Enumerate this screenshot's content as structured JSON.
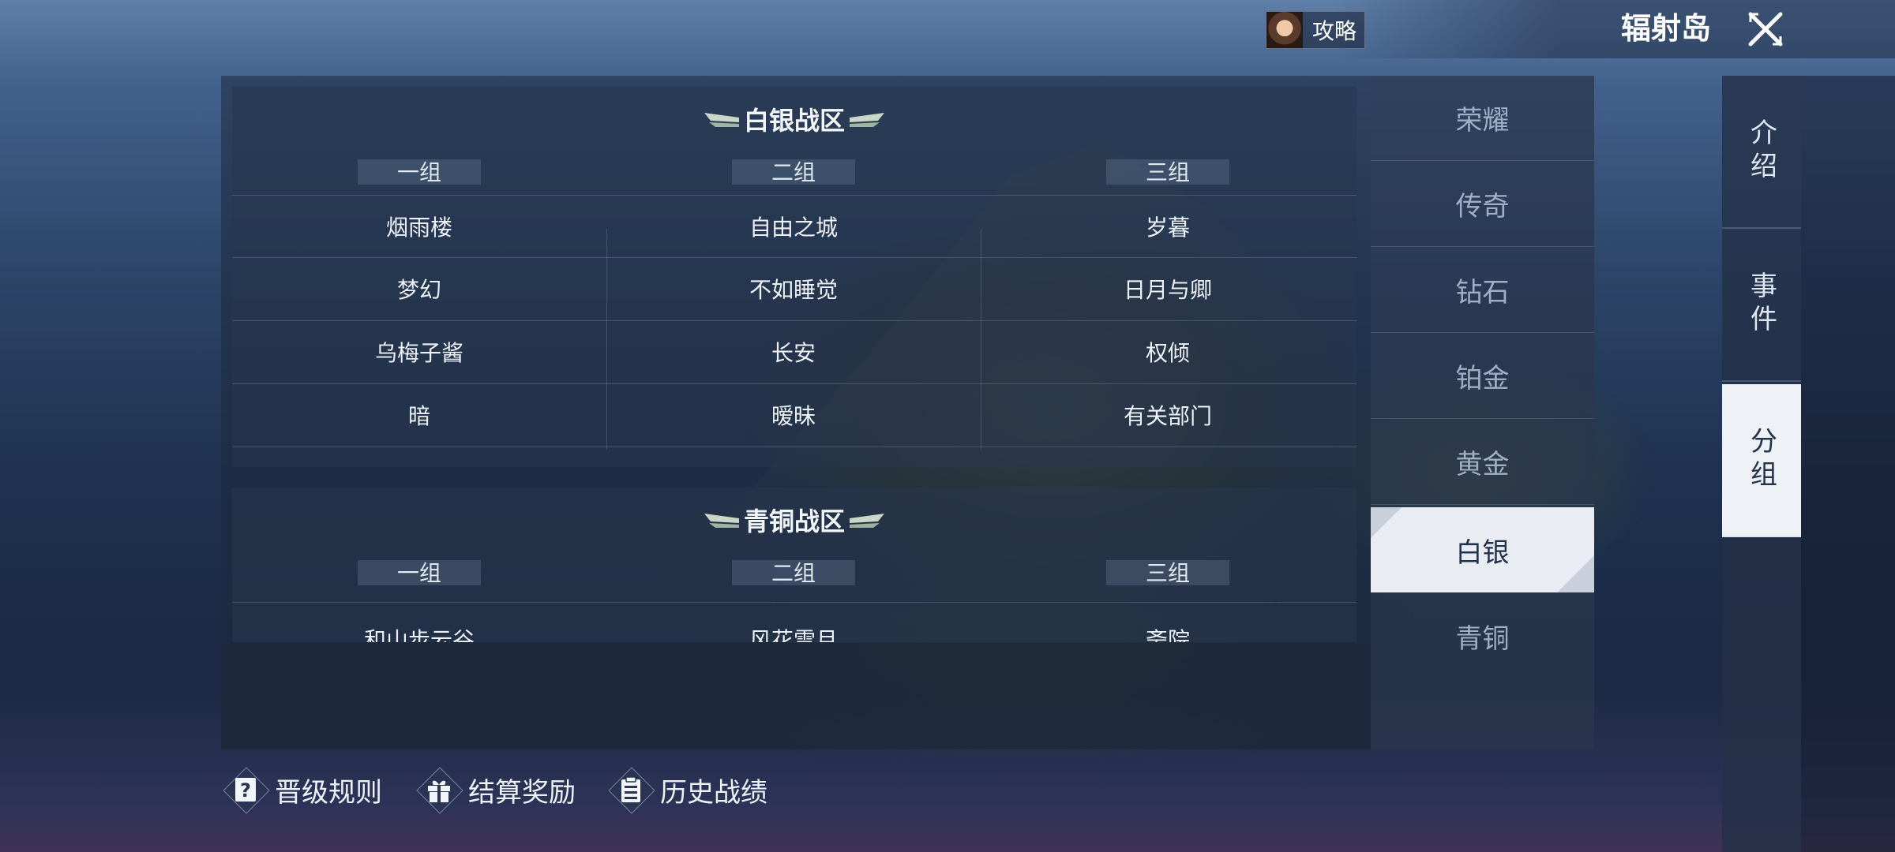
{
  "header": {
    "guide_label": "攻略",
    "map_title": "辐射岛"
  },
  "side_tabs": [
    {
      "label": "介绍",
      "active": false
    },
    {
      "label": "事件",
      "active": false
    },
    {
      "label": "分组",
      "active": true
    }
  ],
  "tiers": [
    {
      "label": "荣耀",
      "active": false
    },
    {
      "label": "传奇",
      "active": false
    },
    {
      "label": "钻石",
      "active": false
    },
    {
      "label": "铂金",
      "active": false
    },
    {
      "label": "黄金",
      "active": false
    },
    {
      "label": "白银",
      "active": true
    },
    {
      "label": "青铜",
      "active": false
    }
  ],
  "zones": [
    {
      "title": "白银战区",
      "groups": [
        "一组",
        "二组",
        "三组"
      ],
      "rows": [
        [
          "烟雨楼",
          "自由之城",
          "岁暮"
        ],
        [
          "梦幻",
          "不如睡觉",
          "日月与卿"
        ],
        [
          "乌梅子酱",
          "长安",
          "权倾"
        ],
        [
          "暗",
          "暧昧",
          "有关部门"
        ]
      ]
    },
    {
      "title": "青铜战区",
      "groups": [
        "一组",
        "二组",
        "三组"
      ],
      "rows": [
        [
          "和山步云谷",
          "风花雪月",
          "斋院"
        ]
      ]
    }
  ],
  "actions": [
    {
      "label": "晋级规则",
      "icon": "question-icon"
    },
    {
      "label": "结算奖励",
      "icon": "gift-icon"
    },
    {
      "label": "历史战绩",
      "icon": "clipboard-icon"
    }
  ],
  "colors": {
    "active_tab_bg": "#eef1f6",
    "active_tab_text": "#24324a",
    "panel_bg": "#1e2a3e"
  }
}
